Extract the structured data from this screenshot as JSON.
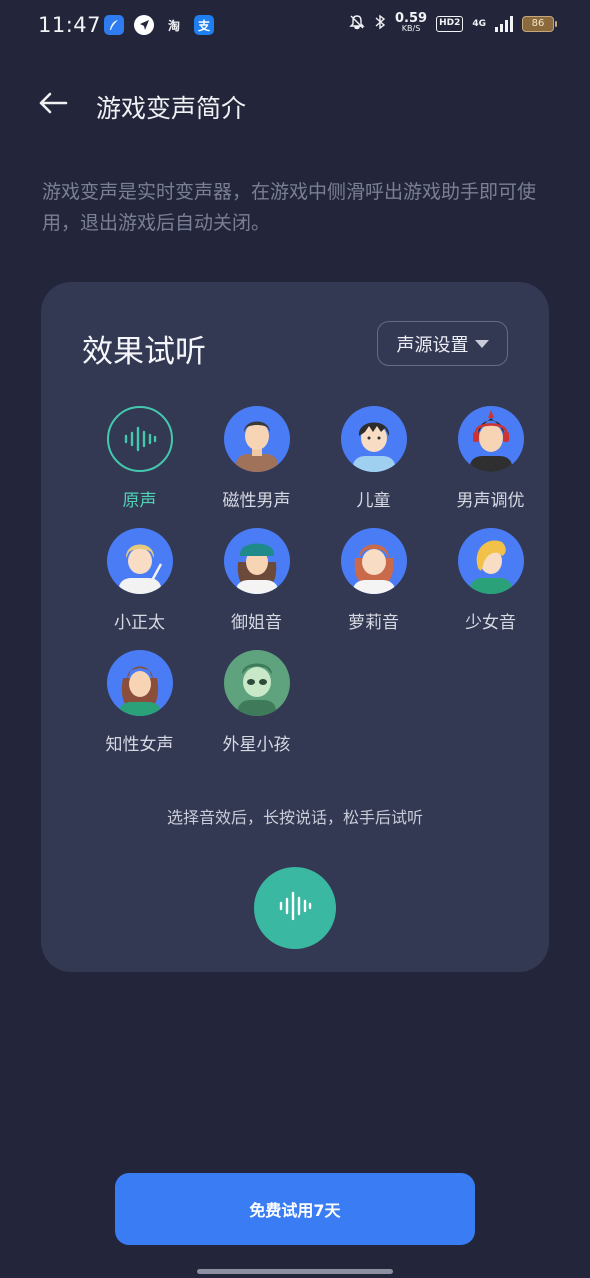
{
  "status_bar": {
    "time": "11:47",
    "net_speed_value": "0.59",
    "net_speed_unit": "KB/S",
    "hd_label": "HD2",
    "network_type": "4G",
    "battery_level": "86",
    "app_icons": [
      "feather-icon",
      "navigation-icon",
      "淘",
      "支"
    ]
  },
  "header": {
    "back_icon": "back-arrow-icon",
    "title": "游戏变声简介"
  },
  "description": "游戏变声是实时变声器，在游戏中侧滑呼出游戏助手即可使用，退出游戏后自动关闭。",
  "card": {
    "title": "效果试听",
    "source_button_label": "声源设置",
    "voices": [
      {
        "label": "原声",
        "active": true,
        "icon": "waveform-icon"
      },
      {
        "label": "磁性男声",
        "active": false,
        "icon": "magnetic-male-avatar"
      },
      {
        "label": "儿童",
        "active": false,
        "icon": "child-avatar"
      },
      {
        "label": "男声调优",
        "active": false,
        "icon": "male-tuned-avatar"
      },
      {
        "label": "小正太",
        "active": false,
        "icon": "young-boy-avatar"
      },
      {
        "label": "御姐音",
        "active": false,
        "icon": "mature-woman-avatar"
      },
      {
        "label": "萝莉音",
        "active": false,
        "icon": "little-girl-avatar"
      },
      {
        "label": "少女音",
        "active": false,
        "icon": "young-girl-avatar"
      },
      {
        "label": "知性女声",
        "active": false,
        "icon": "intellectual-woman-avatar"
      },
      {
        "label": "外星小孩",
        "active": false,
        "icon": "alien-kid-avatar"
      }
    ],
    "hint": "选择音效后，长按说话，松手后试听"
  },
  "trial_button_label": "免费试用7天",
  "colors": {
    "background": "#23263a",
    "card": "#333853",
    "accent": "#3bb8a1",
    "primary_button": "#3a7cf4",
    "avatar_bg": "#4a7df5"
  }
}
